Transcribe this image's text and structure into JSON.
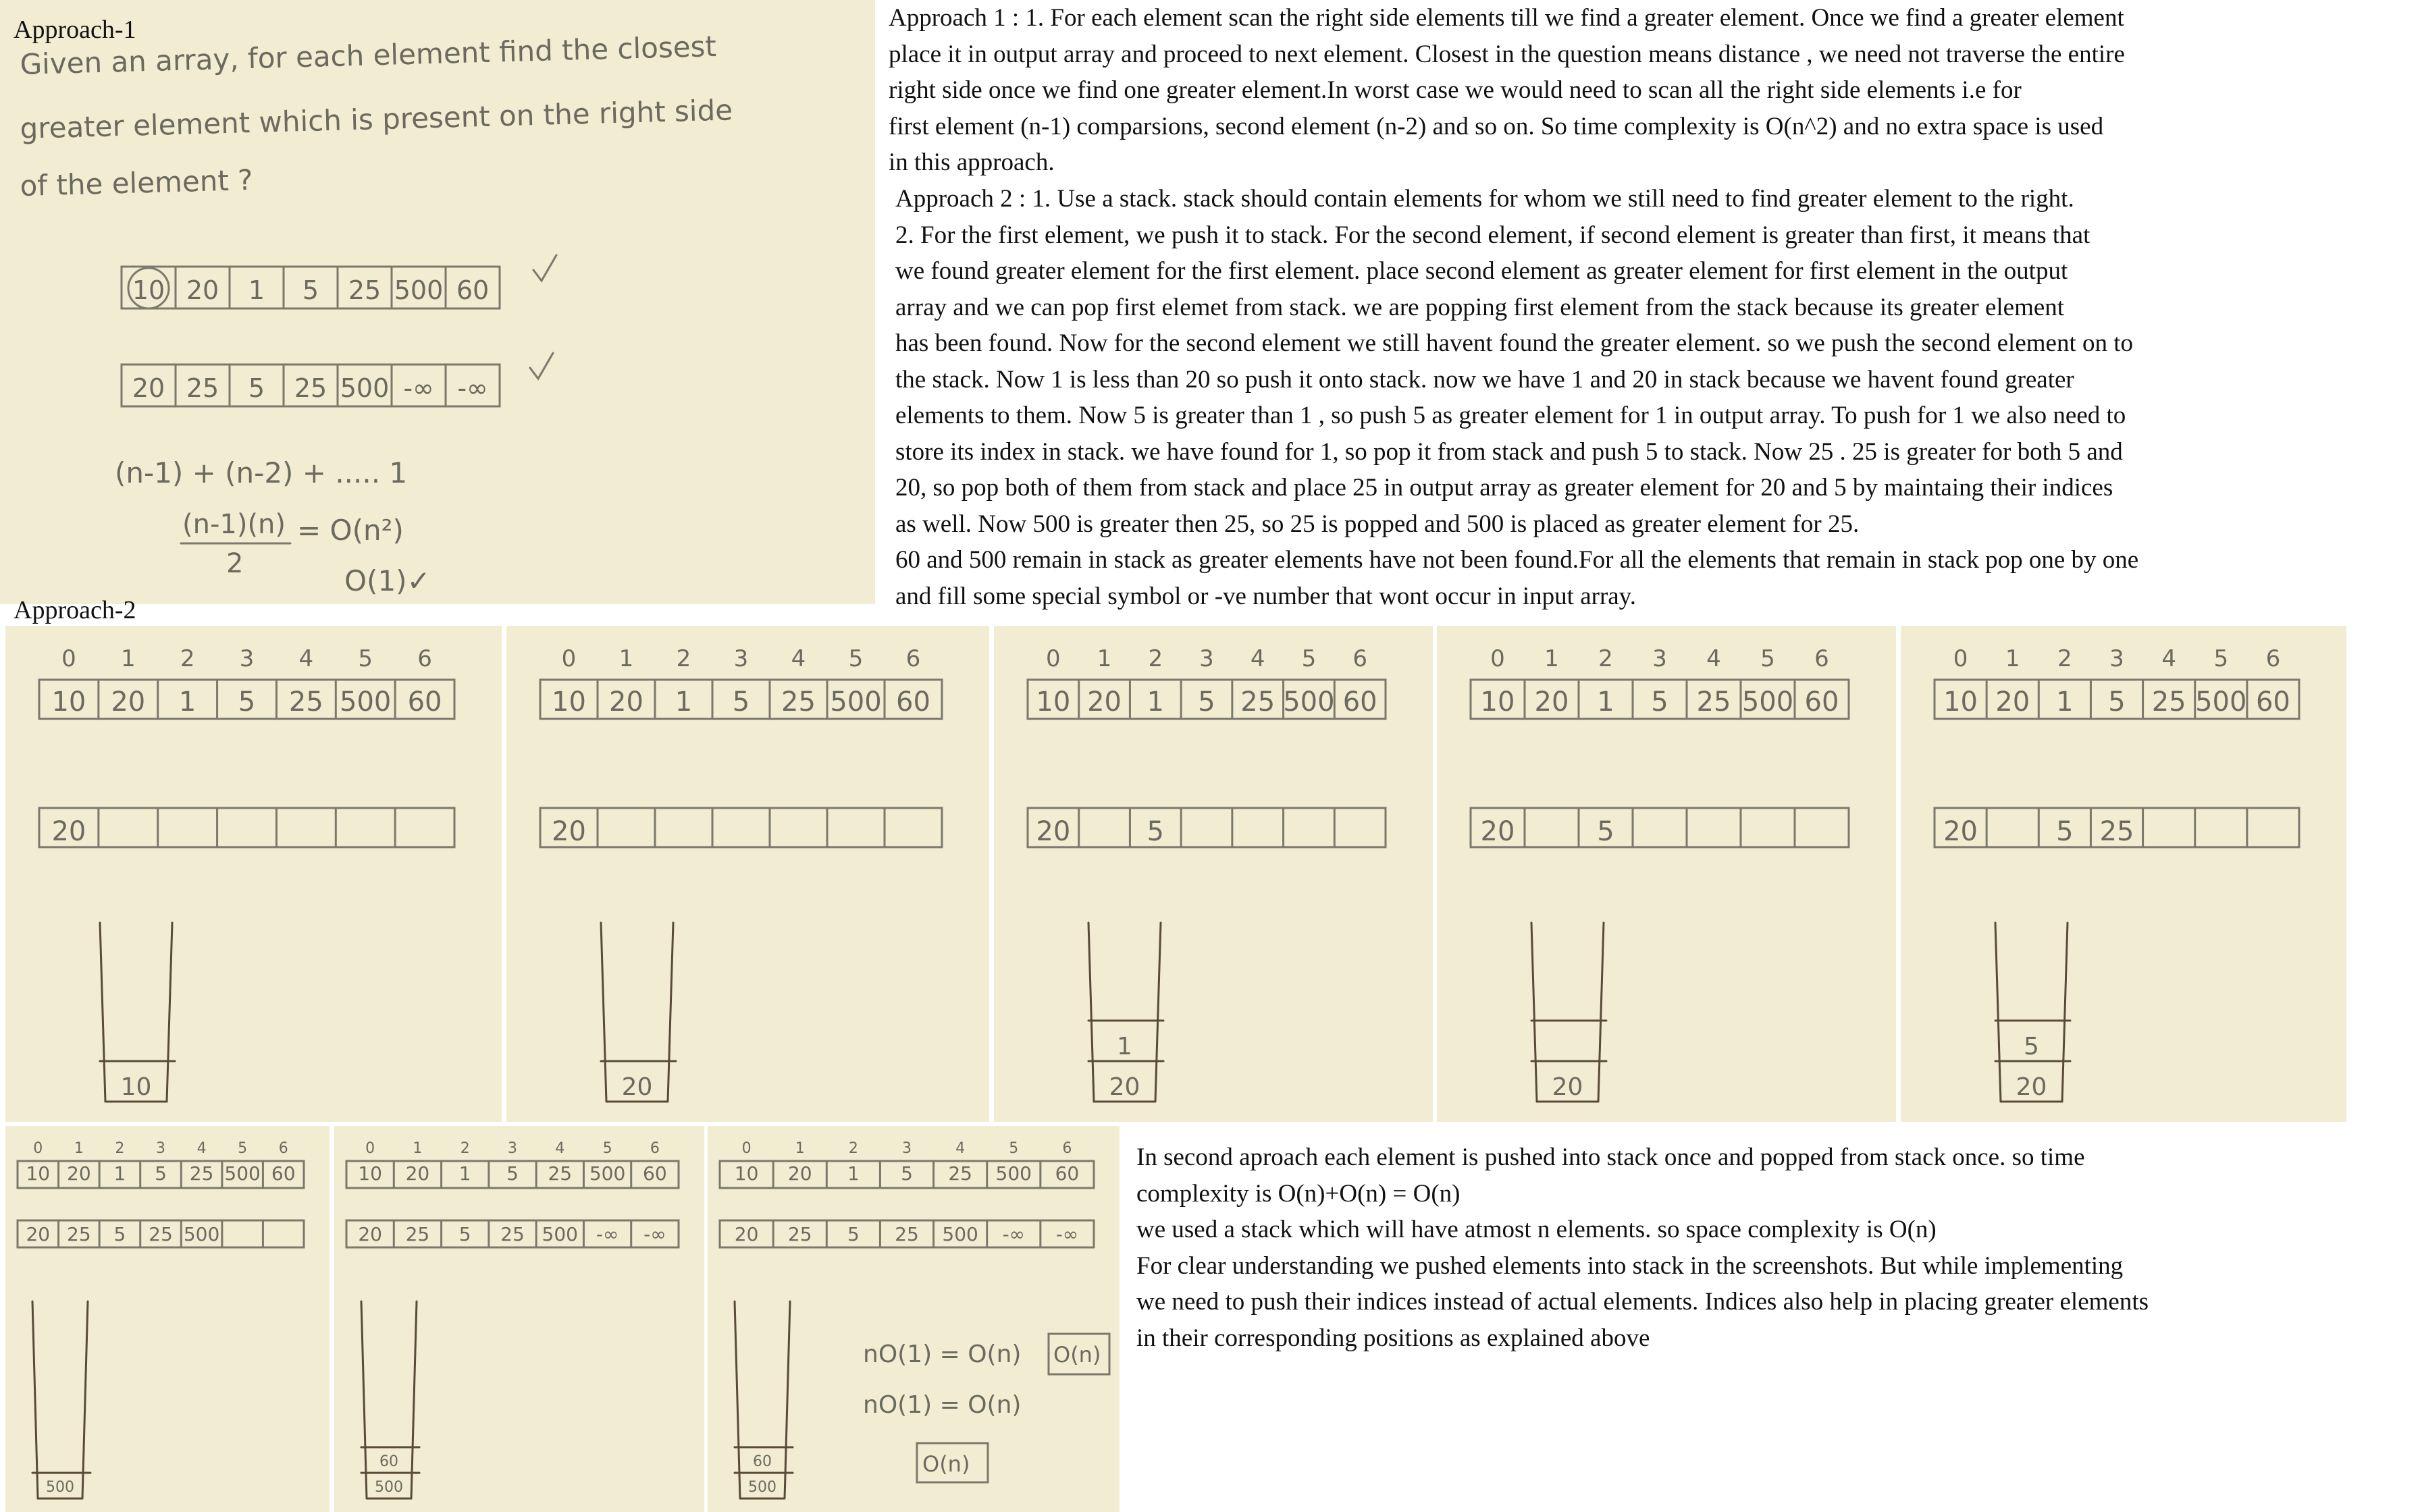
{
  "labels": {
    "approach1": "Approach-1",
    "approach2": "Approach-2"
  },
  "approach1_text": {
    "lines": [
      "Approach 1 : 1. For each element scan the right side elements till we find a greater element. Once we find a greater element",
      "place it in output array and proceed to next element. Closest in the question means distance , we need not traverse the entire",
      "right side once we find one greater element.In worst case we would need to scan all the right side elements i.e for",
      "first element (n-1) comparsions, second element (n-2) and so on. So time complexity is O(n^2) and no extra space is used",
      "in this approach."
    ]
  },
  "approach2_text": {
    "lines": [
      "Approach 2 : 1. Use a stack. stack should contain elements for whom we still need to find greater element to the right.",
      "2. For the first element, we push it to stack. For the second element, if second element is greater than first, it means that",
      "we found greater element for the first element. place second element as greater element for first element in the output",
      "array and we can pop first elemet from stack. we are popping first element from the stack because its greater element",
      "has been found. Now for the second element we still havent found the greater element. so we push the second element on to",
      "the stack. Now 1 is less than 20 so push it onto stack. now we have 1 and 20 in stack because we havent found greater",
      "elements to them. Now 5 is greater than 1 , so push 5 as greater element for 1 in output array. To push for 1 we also need to",
      "store its index in stack. we have found for 1, so pop it from stack and push 5 to stack. Now 25 . 25 is greater for both 5 and",
      "20, so pop both of them from stack and place 25 in output array as greater element for 20 and 5 by maintaing their indices",
      "as well. Now 500 is greater then 25, so 25 is popped and 500 is placed as greater element for 25.",
      "60 and 500 remain in stack as greater elements have not been found.For all the elements that remain in stack pop one by one",
      "and fill some special symbol or -ve number that wont occur in input array."
    ]
  },
  "summary_text": {
    "lines": [
      "In second aproach each element is pushed into stack once and popped from stack once. so time",
      "complexity is O(n)+O(n) = O(n)",
      "we used a stack which will have atmost n elements. so space complexity is O(n)",
      "For clear understanding we pushed elements into stack in the screenshots. But while implementing",
      "we need to push their indices instead of actual elements. Indices also help in placing greater elements",
      "in their corresponding positions as explained above"
    ]
  },
  "whiteboard1": {
    "question": [
      "Given an array, for each element find the closest",
      "greater element which is present on the right side",
      "of the element ?"
    ],
    "input_array": [
      "10",
      "20",
      "1",
      "5",
      "25",
      "500",
      "60"
    ],
    "output_array": [
      "20",
      "25",
      "5",
      "25",
      "500",
      "-∞",
      "-∞"
    ],
    "formula1": "(n-1) + (n-2) + ..... 1",
    "formula2": "(n-1)(n)",
    "formula2_den": "2",
    "formula2_rhs": "= O(n²)",
    "formula3": "O(1)✓"
  },
  "steps": {
    "indices": [
      "0",
      "1",
      "2",
      "3",
      "4",
      "5",
      "6"
    ],
    "input_array": [
      "10",
      "20",
      "1",
      "5",
      "25",
      "500",
      "60"
    ],
    "panels": [
      {
        "output": [
          "20",
          "",
          "",
          "",
          "",
          "",
          ""
        ],
        "stack": [
          "10"
        ]
      },
      {
        "output": [
          "20",
          "",
          "",
          "",
          "",
          "",
          ""
        ],
        "stack": [
          "20"
        ]
      },
      {
        "output": [
          "20",
          "",
          "5",
          "",
          "",
          "",
          ""
        ],
        "stack": [
          "20",
          "1"
        ]
      },
      {
        "output": [
          "20",
          "",
          "5",
          "",
          "",
          "",
          ""
        ],
        "stack": [
          "20",
          ""
        ]
      },
      {
        "output": [
          "20",
          "",
          "5",
          "25",
          "",
          "",
          ""
        ],
        "stack": [
          "20",
          "5"
        ]
      },
      {
        "output": [
          "20",
          "25",
          "5",
          "25",
          "500",
          "",
          ""
        ],
        "stack": [
          "500"
        ]
      },
      {
        "output": [
          "20",
          "25",
          "5",
          "25",
          "500",
          "-∞",
          "-∞"
        ],
        "stack": [
          "500",
          "60"
        ]
      },
      {
        "output": [
          "20",
          "25",
          "5",
          "25",
          "500",
          "-∞",
          "-∞"
        ],
        "stack": [
          "500",
          "60"
        ]
      }
    ],
    "complexity": [
      "nO(1) = O(n)",
      "nO(1) = O(n)",
      "O(n)",
      "O(n)"
    ]
  }
}
